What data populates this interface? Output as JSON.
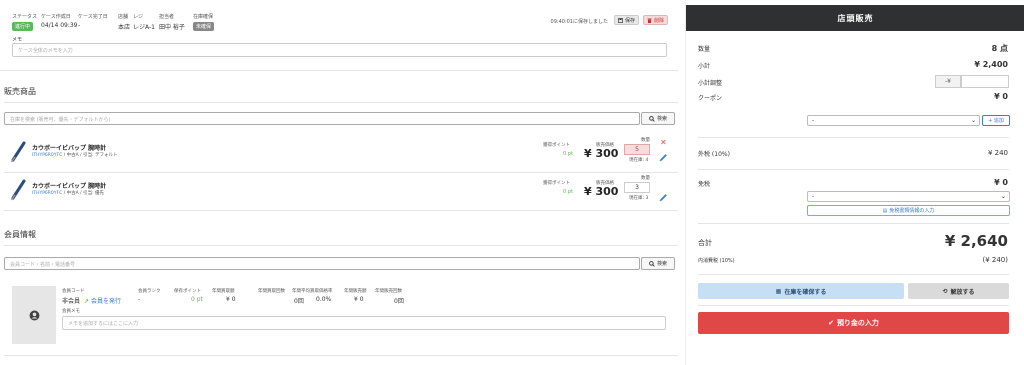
{
  "header": {
    "status_label": "ステータス",
    "status_value": "進行中",
    "created_label": "ケース作成日",
    "created_value": "04/14 09:39",
    "completed_label": "ケース完了日",
    "completed_value": "-",
    "store_label": "店舗",
    "store_value": "本店",
    "register_label": "レジ",
    "register_value": "レジA-1",
    "staff_label": "担当者",
    "staff_value": "田中 裕子",
    "stock_label": "在庫確保",
    "stock_value": "未確保",
    "saved_text": "09:40:01に保存しました",
    "save_label": "保存",
    "delete_label": "削除",
    "memo_label": "メモ",
    "memo_placeholder": "ケース全体のメモを入力"
  },
  "products": {
    "title": "販売商品",
    "search_placeholder": "在庫を検索 (販売可、優先・デフォルトから)",
    "search_button": "検索",
    "items": [
      {
        "name": "カウボーイビバップ 腕時計",
        "code": "ITHYP6R0YFC",
        "detail": " / 中古A / 引当: デフォルト",
        "points_label": "獲得ポイント",
        "points": "0 pt",
        "price_label": "販売価格",
        "price": "¥ 300",
        "qty_label": "数量",
        "qty": "5",
        "stock": "現在庫: 4",
        "qty_warning": true
      },
      {
        "name": "カウボーイビバップ 腕時計",
        "code": "ITHYP6R0YFC",
        "detail": " / 中古A / 引当: 優先",
        "points_label": "獲得ポイント",
        "points": "0 pt",
        "price_label": "販売価格",
        "price": "¥ 300",
        "qty_label": "数量",
        "qty": "3",
        "stock": "現在庫: 3",
        "qty_warning": false
      }
    ]
  },
  "member": {
    "title": "会員情報",
    "search_placeholder": "会員コード・名前・電話番号",
    "search_button": "検索",
    "code_label": "会員コード",
    "code_value": "非会員",
    "issue_link": "会員を発行",
    "rank_label": "会員ランク",
    "rank_value": "-",
    "points_label": "保有ポイント",
    "points_value": "0 pt",
    "annual_purchase_label": "年間買取額",
    "annual_purchase_value": "¥ 0",
    "annual_purchase_count_label": "年間買取回数",
    "annual_purchase_count_value": "0回",
    "avg_rate_label": "年間平均買取価格率",
    "avg_rate_value": "0.0%",
    "annual_sales_label": "年間販売額",
    "annual_sales_value": "¥ 0",
    "annual_sales_count_label": "年間販売回数",
    "annual_sales_count_value": "0回",
    "memo_label": "会員メモ",
    "memo_placeholder": "メモを追加するにはここに入力"
  },
  "summary": {
    "title": "店頭販売",
    "qty_label": "数量",
    "qty_value": "8 点",
    "subtotal_label": "小計",
    "subtotal_value": "¥ 2,400",
    "adjust_label": "小計調整",
    "adjust_prefix": "-¥",
    "coupon_label": "クーポン",
    "coupon_value": "¥ 0",
    "coupon_select": "-",
    "add_button": "+ 追加",
    "ext_tax_label": "外税 (10%)",
    "ext_tax_value": "¥ 240",
    "tax_free_label": "免税",
    "tax_free_value": "¥ 0",
    "tax_free_select": "-",
    "tax_free_button": "免税書類情報の入力",
    "total_label": "合計",
    "total_value": "¥ 2,640",
    "incl_tax_label": "内消費税 (10%)",
    "incl_tax_value": "(¥ 240)",
    "secure_stock_button": "在庫を確保する",
    "release_button": "解放する",
    "deposit_button": "預り金の入力"
  },
  "colors": {
    "header_dark": "#2f3031",
    "status_green": "#5cb85c",
    "danger_red": "#e04848",
    "link_blue": "#3a7bd5"
  }
}
